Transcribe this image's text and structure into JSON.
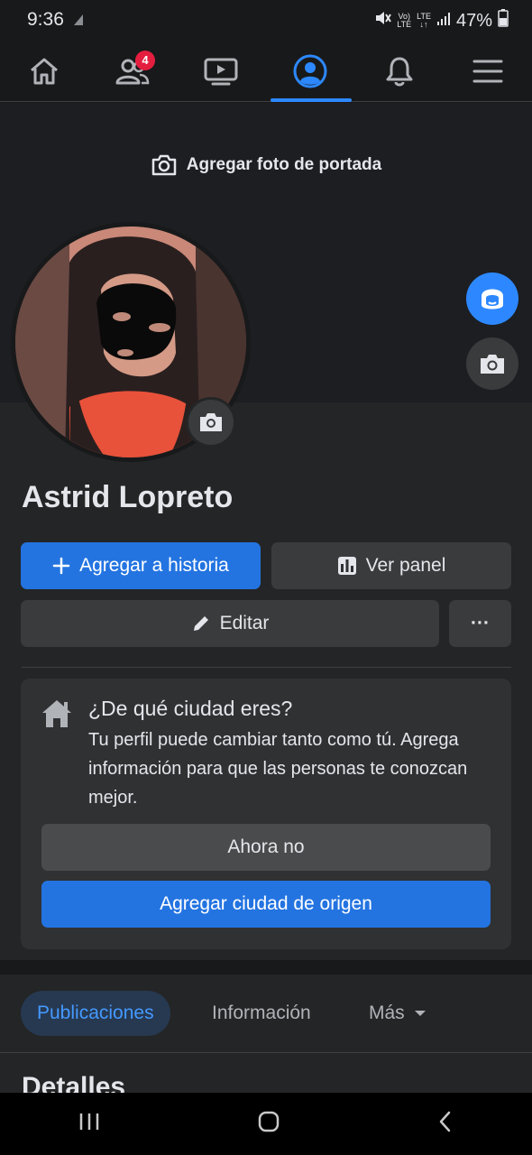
{
  "status_bar": {
    "time": "9:36",
    "battery": "47%",
    "volte_top": "Vo)",
    "volte_bottom": "LTE",
    "lte_top": "LTE",
    "lte_bottom": "↓↑"
  },
  "nav": {
    "items": [
      "home",
      "friends",
      "watch",
      "profile",
      "notifications",
      "menu"
    ],
    "active": "profile",
    "friends_badge": "4"
  },
  "cover": {
    "add_cover_label": "Agregar foto de portada"
  },
  "profile": {
    "name": "Astrid Lopreto",
    "add_story_label": "Agregar a historia",
    "view_panel_label": "Ver panel",
    "edit_label": "Editar",
    "more_label": "···"
  },
  "city_card": {
    "title": "¿De qué ciudad eres?",
    "text": "Tu perfil puede cambiar tanto como tú. Agrega información para que las personas te conozcan mejor.",
    "not_now_label": "Ahora no",
    "add_city_label": "Agregar ciudad de origen"
  },
  "tabs": {
    "items": [
      "Publicaciones",
      "Información",
      "Más"
    ],
    "active": "Publicaciones"
  },
  "details_heading": "Detalles",
  "colors": {
    "background": "#18191a",
    "surface": "#242526",
    "card": "#303133",
    "accent": "#2374e1",
    "active_tab_bg": "#263951",
    "badge": "#e41e3f"
  }
}
